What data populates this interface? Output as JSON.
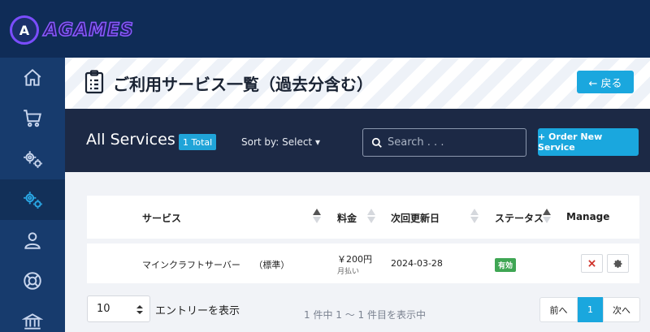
{
  "brand": {
    "logo_text": "AGAMES"
  },
  "sidebar": {
    "items": [
      {
        "icon": "home-icon"
      },
      {
        "icon": "cart-icon"
      },
      {
        "icon": "gears-icon"
      },
      {
        "icon": "gears-icon",
        "active": true
      },
      {
        "icon": "user-icon"
      },
      {
        "icon": "lifebuoy-icon"
      },
      {
        "icon": "bank-icon"
      }
    ]
  },
  "header": {
    "title": "ご利用サービス一覧（過去分含む）",
    "back_label": "← 戻る"
  },
  "services": {
    "title": "All Services",
    "total_badge": "1 Total",
    "sort_label": "Sort by: Select ▾",
    "search_placeholder": "Search . . .",
    "order_button": "+ Order New Service"
  },
  "table": {
    "columns": [
      "サービス",
      "料金",
      "次回更新日",
      "ステータス",
      "Manage"
    ],
    "rows": [
      {
        "service": "マインクラフトサーバー　　（標準）",
        "price": "￥200円",
        "cycle": "月払い",
        "next_due": "2024-03-28",
        "status": "有効"
      }
    ]
  },
  "footer": {
    "entries_value": "10",
    "entries_label": "エントリーを表示",
    "info": "1 件中 1 ～ 1 件目を表示中",
    "prev": "前へ",
    "page": "1",
    "next": "次へ"
  },
  "colors": {
    "accent": "#1aa7de",
    "navbar": "#0f2c57",
    "sidebar": "#173b6d",
    "dark_bar": "#1c2945",
    "success": "#3fa654"
  }
}
